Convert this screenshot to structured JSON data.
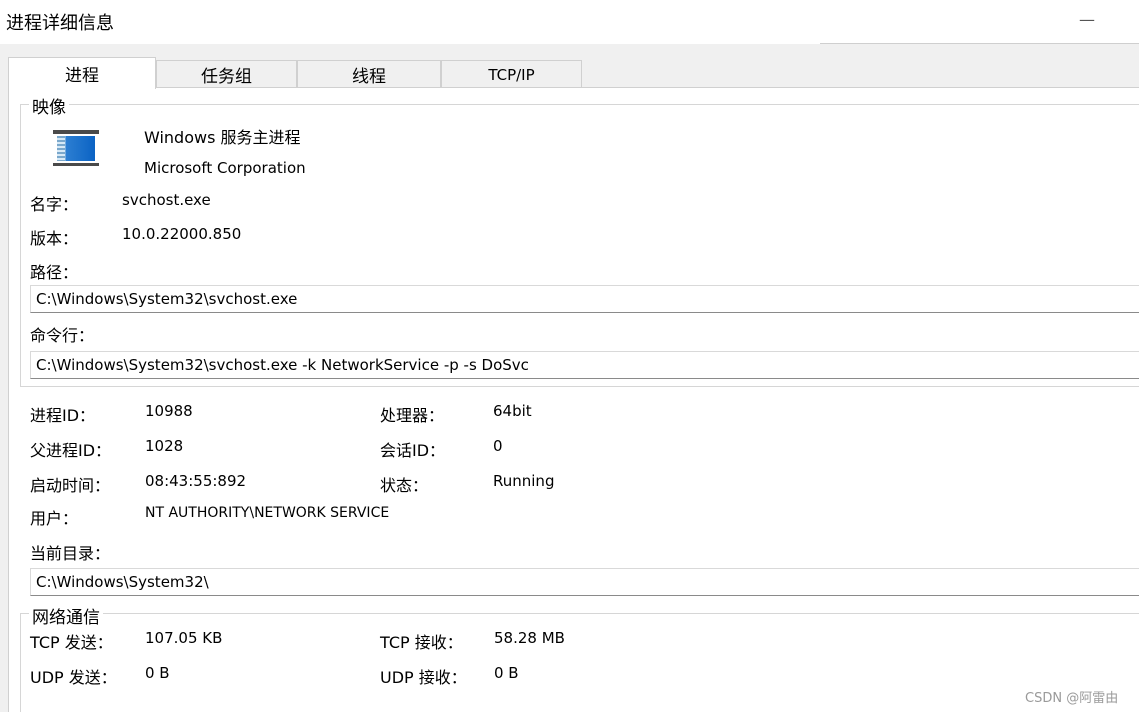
{
  "window": {
    "title": "进程详细信息",
    "minimize_glyph": "—"
  },
  "tabs": [
    "进程",
    "任务组",
    "线程",
    "TCP/IP"
  ],
  "image_group": {
    "legend": "映像",
    "icon": "windows-service-host-icon",
    "description": "Windows 服务主进程",
    "company": "Microsoft Corporation",
    "name_label": "名字：",
    "name_value": "svchost.exe",
    "version_label": "版本：",
    "version_value": "10.0.22000.850",
    "path_label": "路径：",
    "path_value": "C:\\Windows\\System32\\svchost.exe",
    "cmdline_label": "命令行：",
    "cmdline_value": "C:\\Windows\\System32\\svchost.exe -k NetworkService -p -s DoSvc"
  },
  "process_info": {
    "pid_label": "进程ID：",
    "pid_value": "10988",
    "processor_label": "处理器：",
    "processor_value": "64bit",
    "ppid_label": "父进程ID：",
    "ppid_value": "1028",
    "session_label": "会话ID：",
    "session_value": "0",
    "start_label": "启动时间：",
    "start_value": "08:43:55:892",
    "status_label": "状态：",
    "status_value": "Running",
    "user_label": "用户：",
    "user_value": "NT AUTHORITY\\NETWORK SERVICE",
    "cwd_label": "当前目录：",
    "cwd_value": "C:\\Windows\\System32\\"
  },
  "network_group": {
    "legend": "网络通信",
    "tcp_send_label": "TCP 发送：",
    "tcp_send_value": "107.05 KB",
    "tcp_recv_label": "TCP 接收：",
    "tcp_recv_value": "58.28 MB",
    "udp_send_label": "UDP 发送：",
    "udp_send_value": "0 B",
    "udp_recv_label": "UDP 接收：",
    "udp_recv_value": "0 B"
  },
  "watermark": "CSDN @阿雷由"
}
